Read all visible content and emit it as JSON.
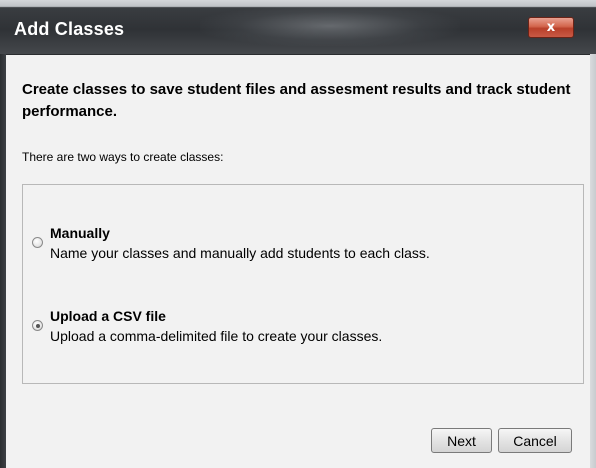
{
  "dialog": {
    "title": "Add Classes",
    "close_label": "x"
  },
  "intro": "Create classes to save student files and assesment results and track student performance.",
  "subtext": "There are two ways to create classes:",
  "options": [
    {
      "title": "Manually",
      "description": "Name your classes and manually add students to each class.",
      "selected": false
    },
    {
      "title": "Upload a CSV file",
      "description": "Upload a comma-delimited file to create your classes.",
      "selected": true
    }
  ],
  "buttons": {
    "next": "Next",
    "cancel": "Cancel"
  }
}
